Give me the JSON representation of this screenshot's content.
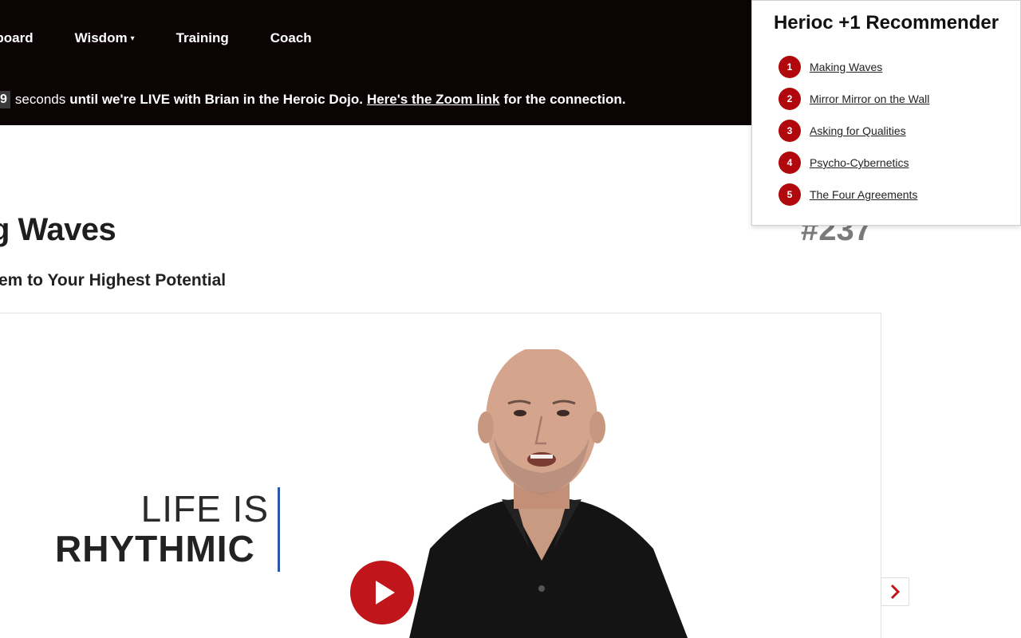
{
  "nav": {
    "items": [
      {
        "label": "hboard"
      },
      {
        "label": "Wisdom",
        "caret": "▾"
      },
      {
        "label": "Training"
      },
      {
        "label": "Coach"
      }
    ]
  },
  "live_banner": {
    "countdown": "9",
    "unit": "seconds",
    "text": "until we're LIVE with Brian in the Heroic Dojo.",
    "link_text": "Here's the Zoom link",
    "suffix": "for the connection."
  },
  "lesson": {
    "title": "g Waves",
    "subtitle": "em to Your Highest Potential",
    "number": "#237"
  },
  "video": {
    "logo_line1": "LIFE IS",
    "logo_line2": "RHYTHMIC"
  },
  "next_icon": "chevron-right-icon",
  "recommender": {
    "title": "Herioc +1 Recommender",
    "items": [
      {
        "num": "1",
        "label": "Making Waves"
      },
      {
        "num": "2",
        "label": "Mirror Mirror on the Wall"
      },
      {
        "num": "3",
        "label": "Asking for Qualities"
      },
      {
        "num": "4",
        "label": "Psycho-Cybernetics"
      },
      {
        "num": "5",
        "label": "The Four Agreements"
      }
    ]
  },
  "colors": {
    "topbar": "#0c0305",
    "accent": "#c0151a",
    "badge": "#b0080d"
  }
}
